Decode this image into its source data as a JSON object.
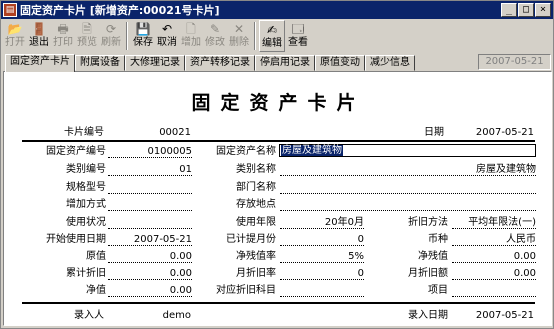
{
  "window": {
    "title": "固定资产卡片 [新增资产:00021号卡片]",
    "controls": [
      "_",
      "□",
      "×"
    ]
  },
  "toolbar": {
    "buttons": [
      {
        "label": "打开",
        "icon": "open-folder-icon",
        "glyph": "📂",
        "enabled": false
      },
      {
        "label": "退出",
        "icon": "exit-icon",
        "glyph": "🚪",
        "enabled": true
      },
      {
        "label": "打印",
        "icon": "print-icon",
        "glyph": "🖶",
        "enabled": false
      },
      {
        "label": "预览",
        "icon": "preview-icon",
        "glyph": "🗎",
        "enabled": false
      },
      {
        "label": "刷新",
        "icon": "refresh-icon",
        "glyph": "⟳",
        "enabled": false
      },
      {
        "label": "保存",
        "icon": "save-icon",
        "glyph": "💾",
        "enabled": true
      },
      {
        "label": "取消",
        "icon": "cancel-icon",
        "glyph": "↶",
        "enabled": true
      },
      {
        "label": "增加",
        "icon": "add-icon",
        "glyph": "🗋",
        "enabled": false
      },
      {
        "label": "修改",
        "icon": "edit-record-icon",
        "glyph": "✎",
        "enabled": false
      },
      {
        "label": "删除",
        "icon": "delete-icon",
        "glyph": "✕",
        "enabled": false
      },
      {
        "label": "编辑",
        "icon": "editor-icon",
        "glyph": "✍",
        "enabled": true
      },
      {
        "label": "查看",
        "icon": "view-icon",
        "glyph": "🗔",
        "enabled": true
      }
    ]
  },
  "tabs": [
    "固定资产卡片",
    "附属设备",
    "大修理记录",
    "资产转移记录",
    "停启用记录",
    "原值变动",
    "减少信息"
  ],
  "header_date": "2007-05-21",
  "card": {
    "title": "固定资产卡片",
    "card_no_label": "卡片编号",
    "card_no": "00021",
    "date_label": "日期",
    "date": "2007-05-21",
    "fields": {
      "asset_code_label": "固定资产编号",
      "asset_code": "0100005",
      "asset_name_label": "固定资产名称",
      "asset_name": "房屋及建筑物",
      "category_code_label": "类别编号",
      "category_code": "01",
      "category_name_label": "类别名称",
      "category_name": "房屋及建筑物",
      "spec_label": "规格型号",
      "spec": "",
      "dept_label": "部门名称",
      "dept": "",
      "add_method_label": "增加方式",
      "add_method": "",
      "location_label": "存放地点",
      "location": "",
      "usage_label": "使用状况",
      "usage": "",
      "life_label": "使用年限",
      "life": "20年0月",
      "depr_method_label": "折旧方法",
      "depr_method": "平均年限法(一)",
      "start_date_label": "开始使用日期",
      "start_date": "2007-05-21",
      "accrued_months_label": "已计提月份",
      "accrued_months": "0",
      "currency_label": "币种",
      "currency": "人民币",
      "original_value_label": "原值",
      "original_value": "0.00",
      "net_salvage_rate_label": "净残值率",
      "net_salvage_rate": "5%",
      "net_salvage_label": "净残值",
      "net_salvage": "0.00",
      "acc_depr_label": "累计折旧",
      "acc_depr": "0.00",
      "monthly_rate_label": "月折旧率",
      "monthly_rate": "0",
      "monthly_amount_label": "月折旧额",
      "monthly_amount": "0.00",
      "net_value_label": "净值",
      "net_value": "0.00",
      "depr_account_label": "对应折旧科目",
      "depr_account": "",
      "project_label": "项目",
      "project": ""
    },
    "recorder_label": "录入人",
    "recorder": "demo",
    "entry_date_label": "录入日期",
    "entry_date": "2007-05-21"
  }
}
